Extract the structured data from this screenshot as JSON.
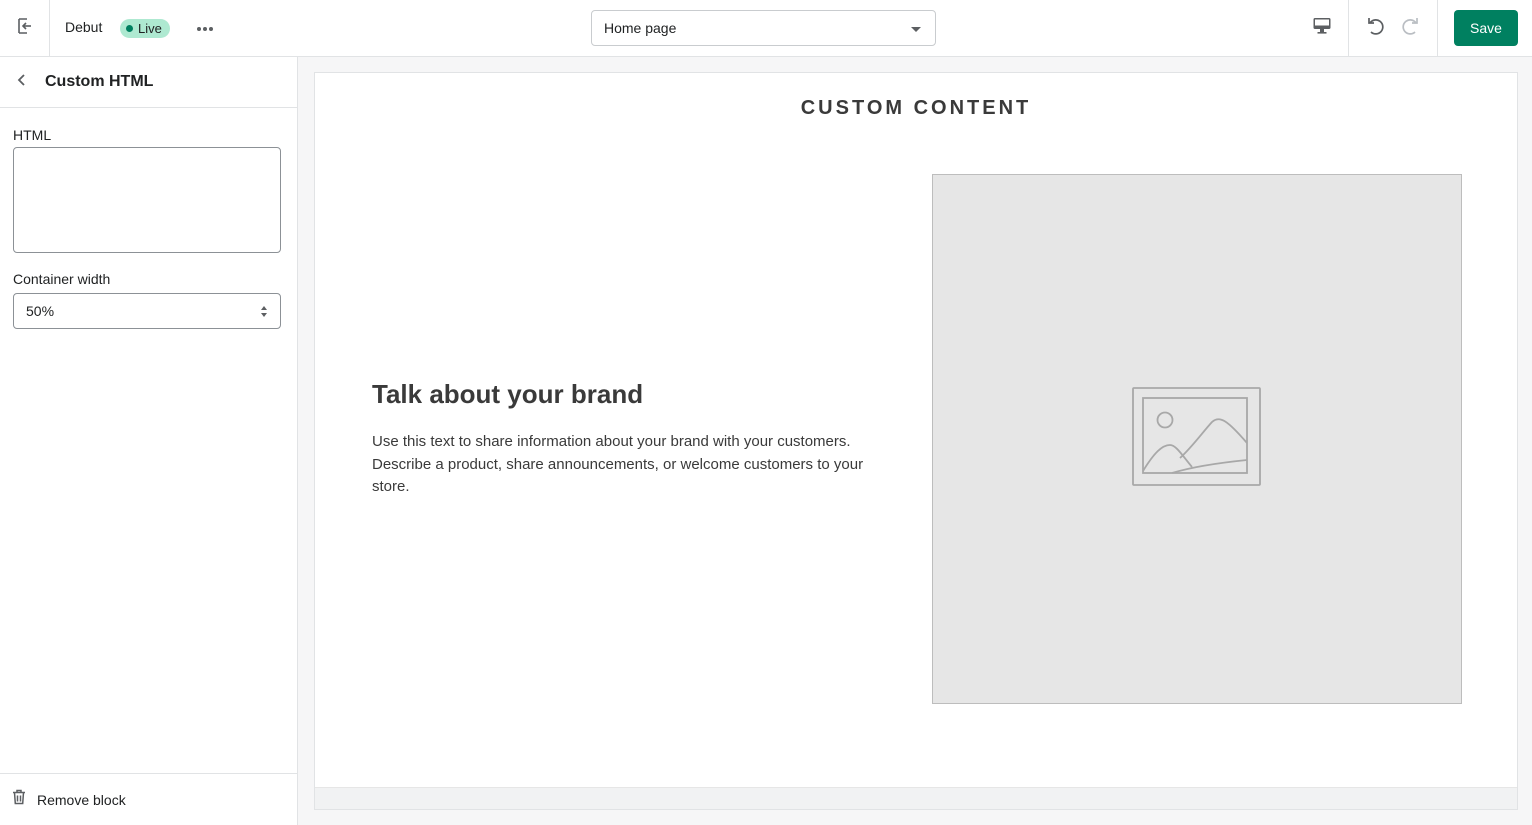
{
  "topbar": {
    "theme_name": "Debut",
    "status_badge": "Live",
    "page_selector": "Home page",
    "save_label": "Save"
  },
  "sidebar": {
    "title": "Custom HTML",
    "html_label": "HTML",
    "html_value": "",
    "container_width_label": "Container width",
    "container_width_value": "50%",
    "remove_block_label": "Remove block"
  },
  "preview": {
    "section_heading": "CUSTOM CONTENT",
    "brand_title": "Talk about your brand",
    "brand_text": "Use this text to share information about your brand with your customers. Describe a product, share announcements, or welcome customers to your store."
  },
  "colors": {
    "accent": "#008060",
    "live_badge_bg": "#aee9d1",
    "live_dot": "#007f5f",
    "placeholder_bg": "#e6e6e6"
  },
  "icons": [
    "exit-icon",
    "more-horizontal-icon",
    "chevron-down-icon",
    "desktop-icon",
    "undo-icon",
    "redo-icon",
    "back-chevron-icon",
    "select-arrows-icon",
    "trash-icon",
    "image-placeholder-icon"
  ]
}
